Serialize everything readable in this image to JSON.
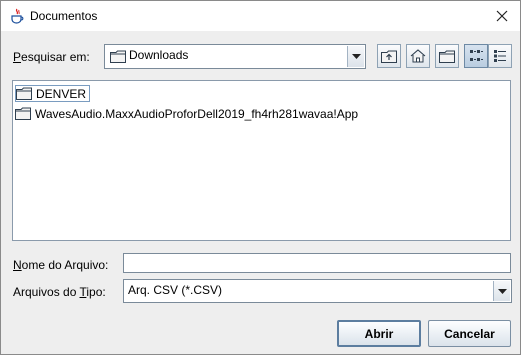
{
  "window": {
    "title": "Documentos",
    "icon": "java-cup-icon",
    "close_glyph": "✕"
  },
  "look_in": {
    "label_pre": "",
    "label_mnemonic": "P",
    "label_post": "esquisar em:",
    "value": "Downloads"
  },
  "toolbar": {
    "buttons": [
      "up-one-level",
      "home",
      "new-folder",
      "list-view",
      "details-view"
    ],
    "active": "list-view"
  },
  "files": [
    {
      "name": "DENVER",
      "type": "folder"
    },
    {
      "name": "WavesAudio.MaxxAudioProforDell2019_fh4rh281wavaa!App",
      "type": "folder"
    }
  ],
  "filename": {
    "label_mnemonic": "N",
    "label_post": "ome do Arquivo:",
    "value": ""
  },
  "filetype": {
    "label_pre": "Arquivos do ",
    "label_mnemonic": "T",
    "label_post": "ipo:",
    "value": "Arq. CSV (*.CSV)"
  },
  "buttons": {
    "open": "Abrir",
    "cancel": "Cancelar"
  },
  "colors": {
    "window_bg": "#eeeeee",
    "folder_fill": "#f3f3f3",
    "folder_stroke": "#2f3f4f",
    "border": "#7a8a99"
  }
}
